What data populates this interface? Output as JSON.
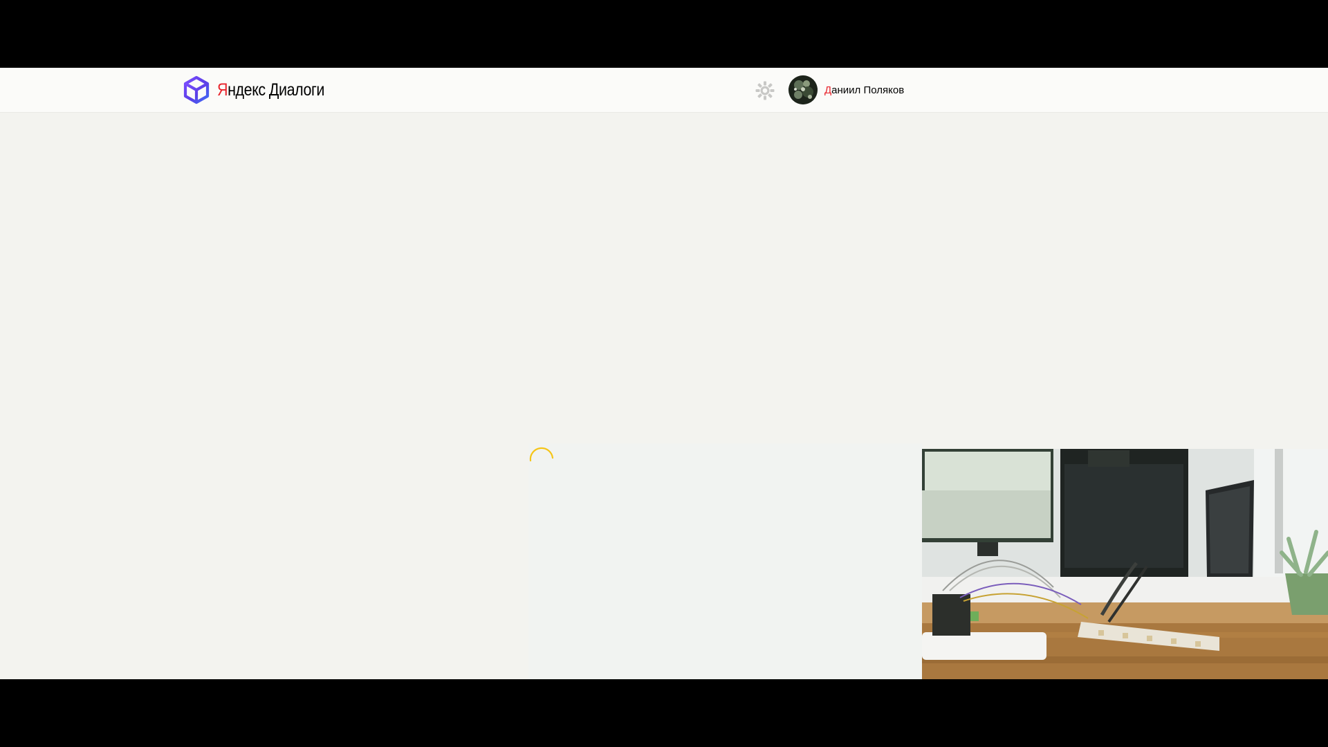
{
  "header": {
    "logo": {
      "brand_first": "Я",
      "brand_rest": "ндекс",
      "product": "Диалоги",
      "icon": "cube-logo-icon"
    },
    "settings": {
      "icon": "gear-icon",
      "color": "#c8c8c6"
    },
    "user": {
      "name_first": "Д",
      "name_rest": "аниил Поляков",
      "avatar": "avatar-photo"
    }
  },
  "main": {
    "loading": true,
    "spinner_color": "#f5c518"
  },
  "video_overlay": {
    "present": true,
    "scene": "desk-with-monitors-and-led-strip"
  },
  "colors": {
    "page_background": "#f3f3ef",
    "header_background": "#fbfbf9",
    "brand_red": "#e8232b",
    "letterbox": "#000000"
  }
}
